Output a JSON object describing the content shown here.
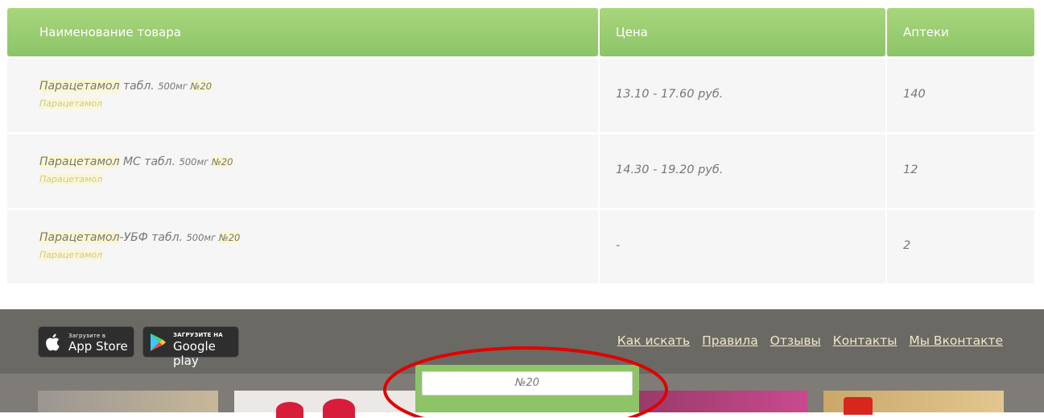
{
  "table": {
    "headers": [
      "Наименование товара",
      "Цена",
      "Аптеки"
    ],
    "rows": [
      {
        "name_main": "Парацетамол",
        "name_rest": " табл. ",
        "dose": "500мг ",
        "count": "№20",
        "sub": "Парацетамол",
        "price": "13.10 - 17.60 руб.",
        "pharmacies": "140"
      },
      {
        "name_main": "Парацетамол",
        "name_rest": " МС табл. ",
        "dose": "500мг ",
        "count": "№20",
        "sub": "Парацетамол",
        "price": "14.30 - 19.20 руб.",
        "pharmacies": "12"
      },
      {
        "name_main": "Парацетамол",
        "name_rest": "-УБФ табл. ",
        "dose": "500мг ",
        "count": "№20",
        "sub": "Парацетамол",
        "price": "-",
        "pharmacies": "2"
      }
    ]
  },
  "footer": {
    "app_store": {
      "small": "Загрузите в",
      "big": "App Store"
    },
    "google_play": {
      "small": "ЗАГРУЗИТЕ НА",
      "big": "Google play"
    },
    "links": [
      "Как искать",
      "Правила",
      "Отзывы",
      "Контакты",
      "Мы Вконтакте"
    ]
  },
  "search": {
    "value": "№20"
  },
  "colors": {
    "header_green": "#8dc468",
    "footer": "#6b6964",
    "link": "#efe6c7",
    "highlight": "#fcf7d2",
    "ellipse": "#e00000"
  }
}
